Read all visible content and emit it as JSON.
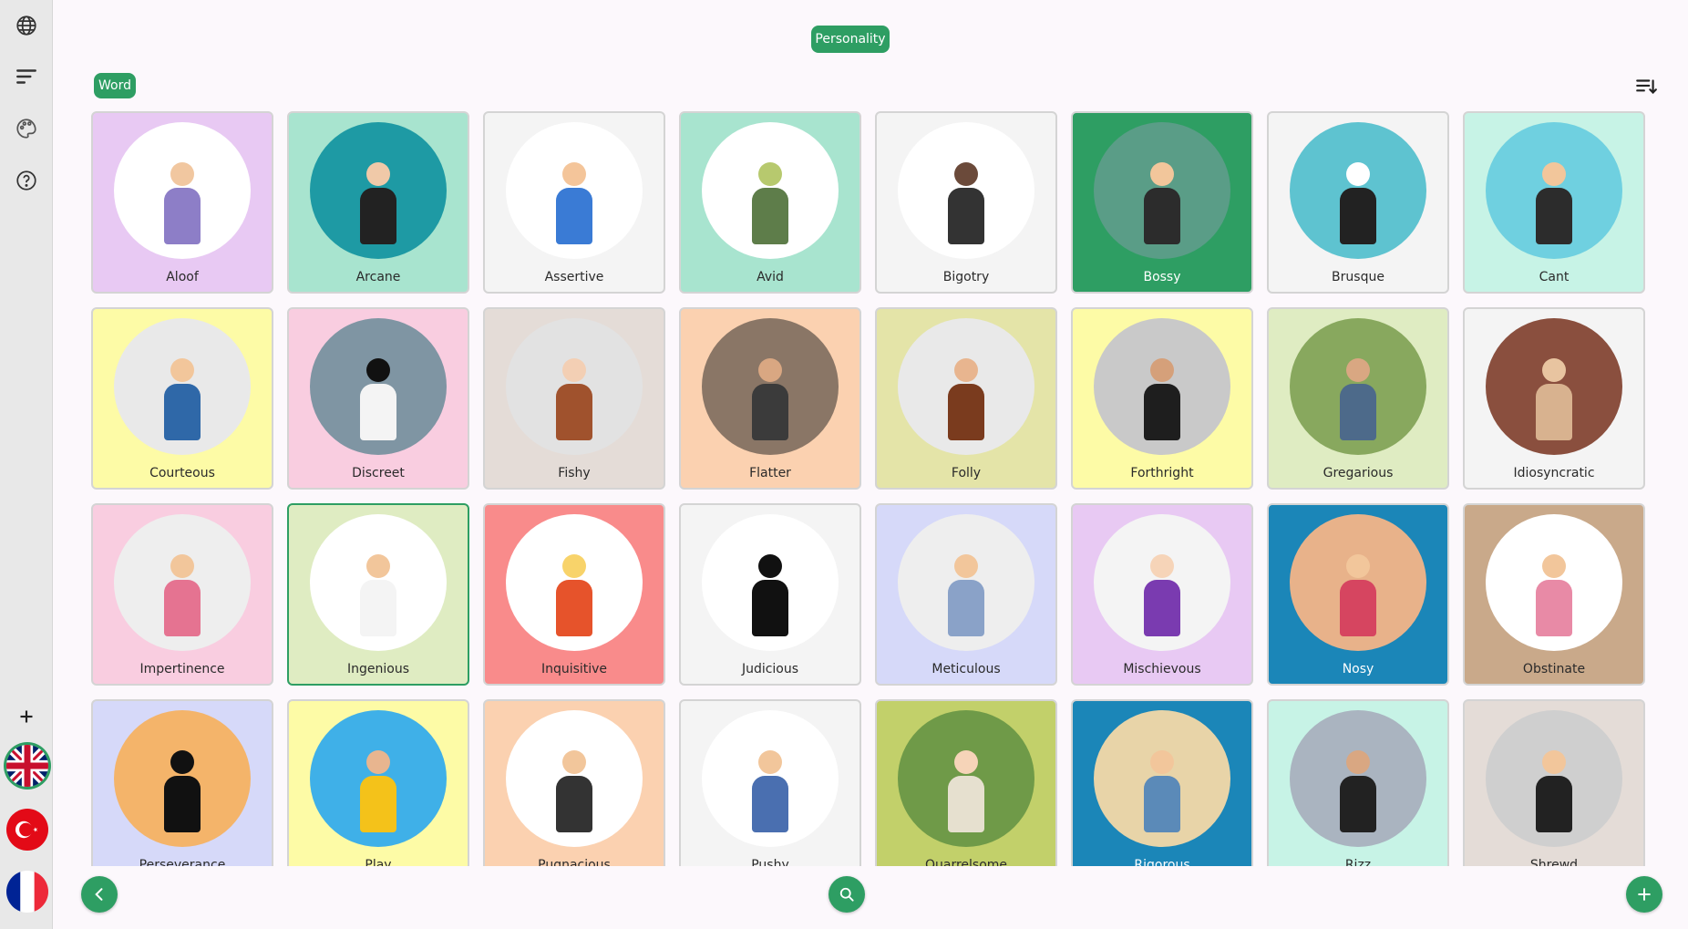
{
  "header": {
    "category_label": "Personality",
    "filter_label": "Word"
  },
  "colors": {
    "accent": "#2e9e63",
    "sidebar": "#e8e8e8"
  },
  "sidebar": {
    "icons": [
      "globe-icon",
      "menu-lines-icon",
      "palette-icon",
      "help-icon",
      "plus-icon"
    ],
    "languages": [
      "english-flag",
      "turkish-flag",
      "french-flag"
    ]
  },
  "cards": [
    {
      "label": "Aloof",
      "bg": "#e8c9f3",
      "circle": "#ffffff",
      "skin": "#f1c7a0",
      "shirt": "#8d7ec7"
    },
    {
      "label": "Arcane",
      "bg": "#a8e4cf",
      "circle": "#1e9aa4",
      "skin": "#f0c9a8",
      "shirt": "#222222"
    },
    {
      "label": "Assertive",
      "bg": "#f4f4f4",
      "circle": "#ffffff",
      "skin": "#f4c59a",
      "shirt": "#3a7bd5"
    },
    {
      "label": "Avid",
      "bg": "#a8e4cf",
      "circle": "#ffffff",
      "skin": "#b7c96e",
      "shirt": "#5e7d4a"
    },
    {
      "label": "Bigotry",
      "bg": "#f4f4f4",
      "circle": "#ffffff",
      "skin": "#6b4a3a",
      "shirt": "#333333"
    },
    {
      "label": "Bossy",
      "bg": "#2e9e63",
      "circle": "#5a9d87",
      "skin": "#f2c69b",
      "shirt": "#2c2c2c",
      "light_label": true
    },
    {
      "label": "Brusque",
      "bg": "#f4f4f4",
      "circle": "#5ec3d0",
      "skin": "#ffffff",
      "shirt": "#222222"
    },
    {
      "label": "Cant",
      "bg": "#c7f3e6",
      "circle": "#6fd0e0",
      "skin": "#f2c69b",
      "shirt": "#2c2c2c"
    },
    {
      "label": "Courteous",
      "bg": "#fdfba6",
      "circle": "#e9e9e9",
      "skin": "#f2c69b",
      "shirt": "#2f68a8"
    },
    {
      "label": "Discreet",
      "bg": "#f9cde0",
      "circle": "#7f95a3",
      "skin": "#111111",
      "shirt": "#f4f4f4"
    },
    {
      "label": "Fishy",
      "bg": "#e4dcd7",
      "circle": "#e2e2e2",
      "skin": "#f3cfb4",
      "shirt": "#a0522d"
    },
    {
      "label": "Flatter",
      "bg": "#fbd1b0",
      "circle": "#8a7666",
      "skin": "#d9a782",
      "shirt": "#3b3b3b"
    },
    {
      "label": "Folly",
      "bg": "#e4e4a8",
      "circle": "#e9e9e9",
      "skin": "#e8b58f",
      "shirt": "#7a3b1e"
    },
    {
      "label": "Forthright",
      "bg": "#fdfba6",
      "circle": "#c9c9c9",
      "skin": "#d5a07a",
      "shirt": "#1e1e1e"
    },
    {
      "label": "Gregarious",
      "bg": "#dfecc2",
      "circle": "#88a85e",
      "skin": "#d9a782",
      "shirt": "#4d6a8a"
    },
    {
      "label": "Idiosyncratic",
      "bg": "#f4f4f4",
      "circle": "#8a4f3e",
      "skin": "#e8c4a0",
      "shirt": "#d8b28f"
    },
    {
      "label": "Impertinence",
      "bg": "#f9cde0",
      "circle": "#eeeeee",
      "skin": "#f2c69b",
      "shirt": "#e57391"
    },
    {
      "label": "Ingenious",
      "bg": "#dfecc2",
      "circle": "#ffffff",
      "skin": "#f2c69b",
      "shirt": "#f4f4f4",
      "selected": true
    },
    {
      "label": "Inquisitive",
      "bg": "#f98b8b",
      "circle": "#ffffff",
      "skin": "#f8d36a",
      "shirt": "#e6532b"
    },
    {
      "label": "Judicious",
      "bg": "#f4f4f4",
      "circle": "#ffffff",
      "skin": "#111111",
      "shirt": "#111111"
    },
    {
      "label": "Meticulous",
      "bg": "#d6d9f9",
      "circle": "#eeeeee",
      "skin": "#f2c69b",
      "shirt": "#8aa2c8"
    },
    {
      "label": "Mischievous",
      "bg": "#e8c9f3",
      "circle": "#f4f4f4",
      "skin": "#f6d4b8",
      "shirt": "#7a3bb0"
    },
    {
      "label": "Nosy",
      "bg": "#1b86b8",
      "circle": "#e8b28a",
      "skin": "#f2c69b",
      "shirt": "#d64560",
      "light_label": true
    },
    {
      "label": "Obstinate",
      "bg": "#c9a98a",
      "circle": "#ffffff",
      "skin": "#f2c69b",
      "shirt": "#e88aa6"
    },
    {
      "label": "Perseverance",
      "bg": "#d6d9f9",
      "circle": "#f4b46a",
      "skin": "#111111",
      "shirt": "#111111"
    },
    {
      "label": "Play",
      "bg": "#fdfba6",
      "circle": "#3fb0e8",
      "skin": "#e8b58f",
      "shirt": "#f4c21a"
    },
    {
      "label": "Pugnacious",
      "bg": "#fbd1b0",
      "circle": "#ffffff",
      "skin": "#f2c69b",
      "shirt": "#333333"
    },
    {
      "label": "Pushy",
      "bg": "#f4f4f4",
      "circle": "#ffffff",
      "skin": "#f2c69b",
      "shirt": "#4a6fb0"
    },
    {
      "label": "Quarrelsome",
      "bg": "#c2d06a",
      "circle": "#6f9a48",
      "skin": "#f6d4b8",
      "shirt": "#e6e0cf"
    },
    {
      "label": "Rigorous",
      "bg": "#1b86b8",
      "circle": "#e8d4a8",
      "skin": "#f2c69b",
      "shirt": "#5b8ab8",
      "light_label": true
    },
    {
      "label": "Rizz",
      "bg": "#c7f3e6",
      "circle": "#aab4c0",
      "skin": "#d9a782",
      "shirt": "#222222"
    },
    {
      "label": "Shrewd",
      "bg": "#e4dcd7",
      "circle": "#cfcfcf",
      "skin": "#f2c69b",
      "shirt": "#222222"
    }
  ]
}
